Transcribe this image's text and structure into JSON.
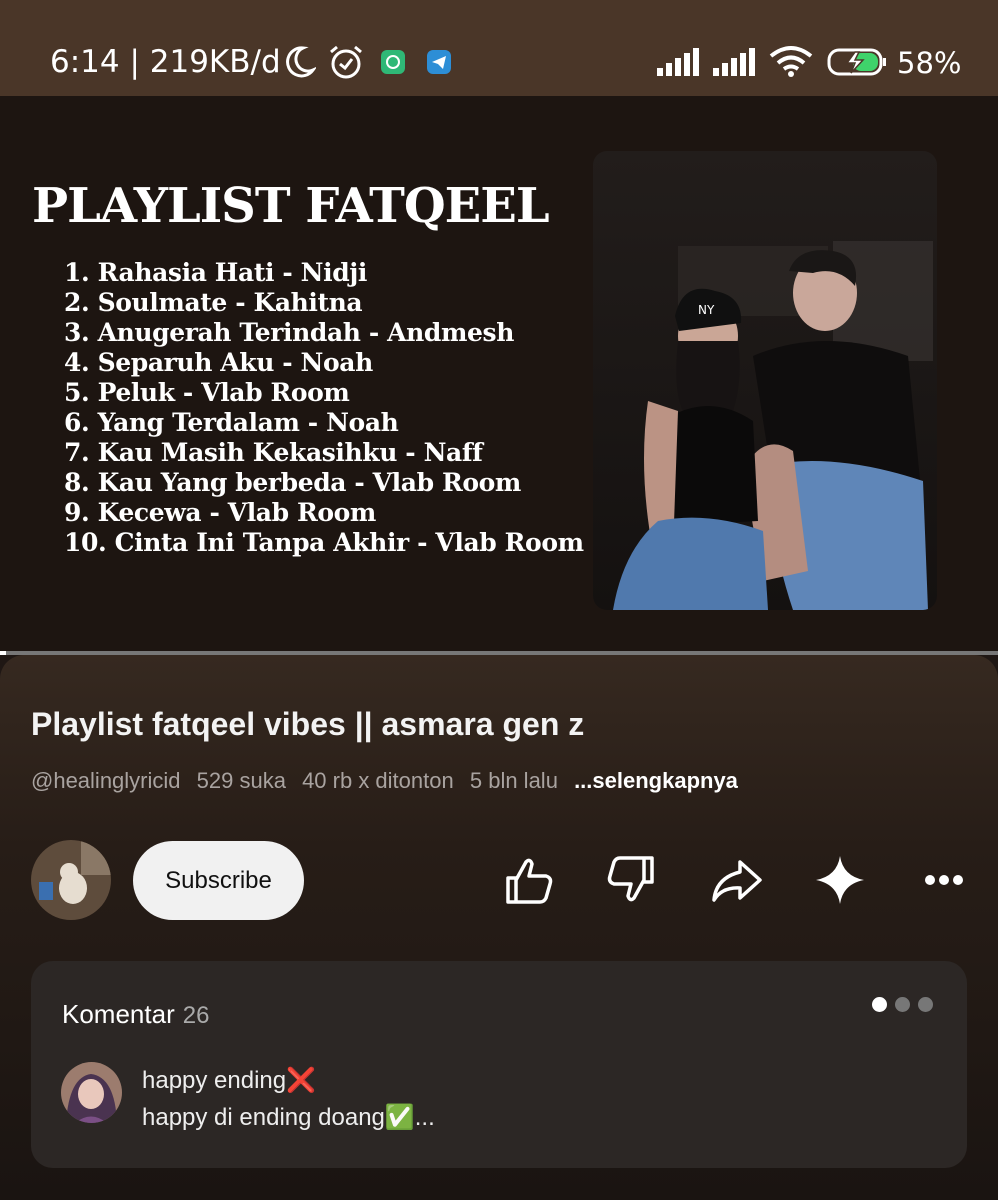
{
  "status_bar": {
    "time": "6:14 | 219KB/d",
    "icons": [
      "moon-icon",
      "alarm-icon",
      "whatsapp-icon",
      "telegram-icon",
      "signal-icon",
      "signal-icon",
      "wifi-icon",
      "battery-charging-icon"
    ],
    "battery": "58%"
  },
  "video": {
    "title": "PLAYLIST FATQEEL",
    "tracks": [
      "1. Rahasia Hati - Nidji",
      "2. Soulmate - Kahitna",
      "3. Anugerah Terindah - Andmesh",
      "4. Separuh Aku - Noah",
      "5. Peluk - Vlab Room",
      "6. Yang Terdalam - Noah",
      "7. Kau Masih Kekasihku - Naff",
      "8. Kau Yang berbeda - Vlab Room",
      "9. Kecewa - Vlab Room",
      "10. Cinta Ini Tanpa Akhir - Vlab Room"
    ],
    "cap_text": "NY",
    "progress": 0.006
  },
  "details": {
    "title": "Playlist fatqeel vibes || asmara gen z",
    "channel": "@healinglyricid",
    "likes": "529 suka",
    "views": "40 rb x ditonton",
    "age": "5 bln lalu",
    "more": "...selengkapnya",
    "subscribe": "Subscribe"
  },
  "actions": [
    "like-icon",
    "dislike-icon",
    "share-icon",
    "sparkle-icon",
    "more-icon"
  ],
  "comments": {
    "label": "Komentar",
    "count": "26",
    "line1": "happy ending❌",
    "line2": "happy di ending doang✅..."
  },
  "colors": {
    "status_bar_bg": "#4a3628",
    "video_bg": "#1d1511",
    "panel_bg": "#271d17",
    "comments_bg": "#2c2725"
  }
}
